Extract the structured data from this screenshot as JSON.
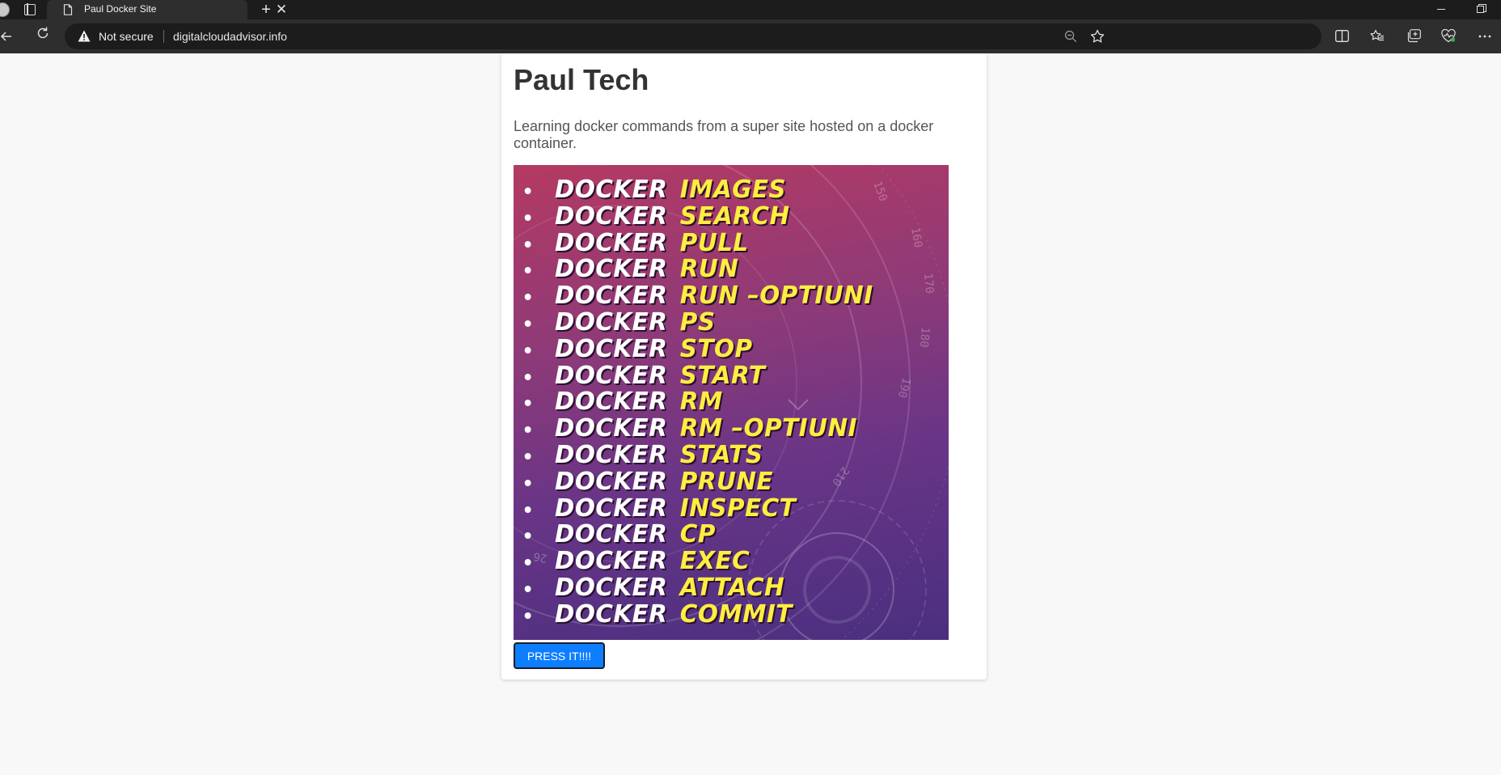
{
  "browser": {
    "tab_title": "Paul Docker Site",
    "tab_close_glyph": "✕",
    "new_tab_glyph": "+",
    "security_label": "Not secure",
    "url": "digitalcloudadvisor.info"
  },
  "page": {
    "heading": "Paul Tech",
    "description": "Learning docker commands from a super site hosted on a docker container.",
    "poster": {
      "keyword": "DOCKER",
      "commands": [
        "IMAGES",
        "SEARCH",
        "PULL",
        "RUN",
        "RUN –OPTIUNI",
        "PS",
        "STOP",
        "START",
        "RM",
        "RM –OPTIUNI",
        "STATS",
        "PRUNE",
        "INSPECT",
        "CP",
        "EXEC",
        "ATTACH",
        "COMMIT"
      ],
      "dial_numbers": [
        "150",
        "160",
        "170",
        "180",
        "190",
        "210",
        "26"
      ],
      "colors": {
        "keyword": "#ffffff",
        "argument": "#ffee40",
        "bg_top": "#b43a62",
        "bg_bottom": "#4a2f80"
      }
    },
    "button_label": "PRESS IT!!!!",
    "button_color": "#0d7eff"
  },
  "icons": [
    "profile-avatar-icon",
    "tab-actions-icon",
    "page-icon",
    "close-icon",
    "plus-icon",
    "minimize-icon",
    "restore-icon",
    "back-icon",
    "refresh-icon",
    "warning-icon",
    "zoom-out-icon",
    "star-icon",
    "split-screen-icon",
    "favorites-icon",
    "collections-icon",
    "browser-essentials-icon",
    "more-icon"
  ]
}
